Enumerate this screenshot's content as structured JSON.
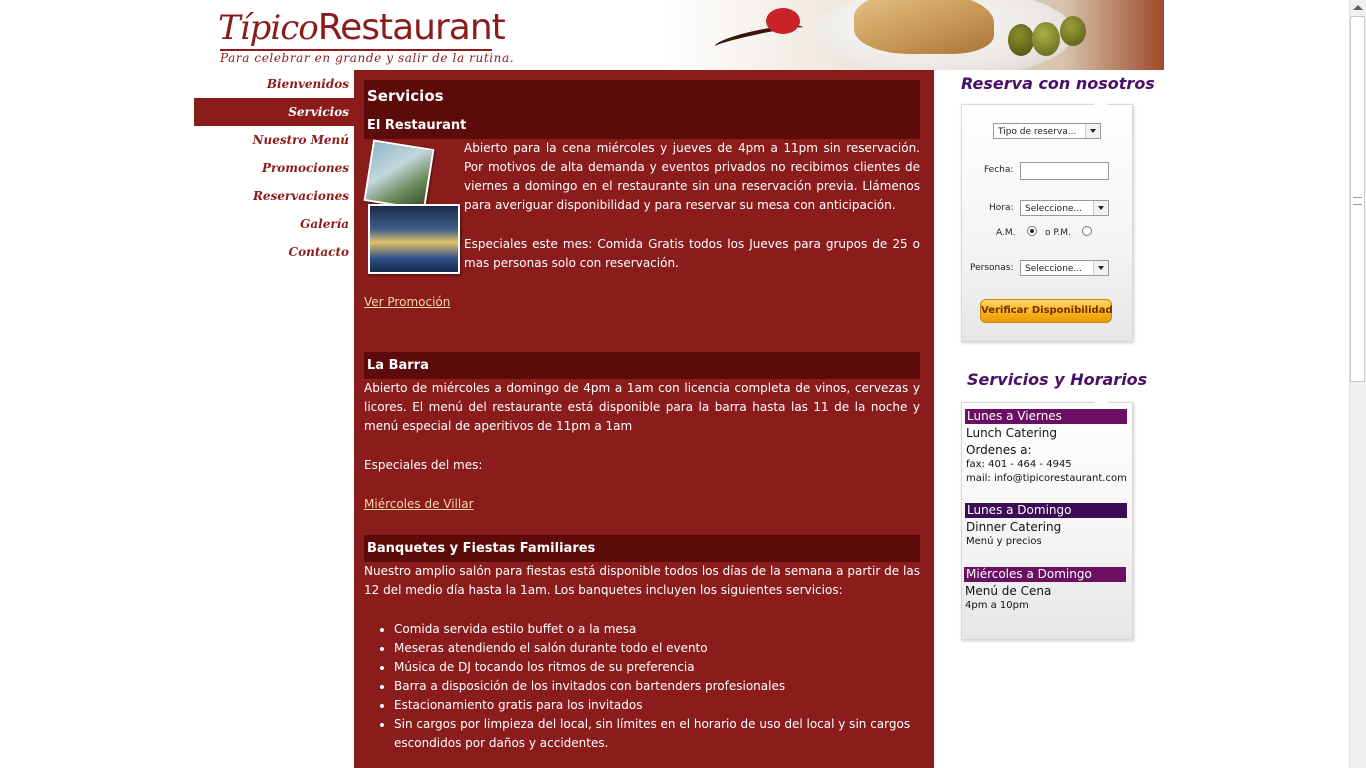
{
  "brand": {
    "name_italic": "Típico",
    "name_rest": "Restaurant",
    "tagline": "Para celebrar en grande y salir de la rutina."
  },
  "nav": {
    "items": [
      {
        "label": "Bienvenidos"
      },
      {
        "label": "Servicios",
        "active": true
      },
      {
        "label": "Nuestro Menú"
      },
      {
        "label": "Promociones"
      },
      {
        "label": "Reservaciones"
      },
      {
        "label": "Galería"
      },
      {
        "label": "Contacto"
      }
    ]
  },
  "main": {
    "title": "Servicios",
    "restaurant": {
      "heading": "El Restaurant",
      "p1": "Abierto para la cena miércoles y jueves de 4pm a 11pm sin reservación. Por motivos de alta demanda y eventos privados no recibimos clientes de viernes a domingo en el restaurante sin una reservación previa. Llámenos para averiguar disponibilidad y para reservar su mesa con anticipación.",
      "p2": "Especiales este mes: Comida Gratis todos los Jueves para grupos de 25 o mas personas solo con reservación.",
      "link": "Ver Promoción"
    },
    "barra": {
      "heading": "La Barra",
      "p1": "Abierto de miércoles a domingo de 4pm a 1am con licencia completa de vinos, cervezas y licores. El menú del restaurante está disponible para la barra hasta las 11 de la noche y menú especial de aperitivos de 11pm a 1am",
      "p2": "Especiales del mes:",
      "link": "Miércoles de Villar"
    },
    "banquetes": {
      "heading": "Banquetes y Fiestas Familiares",
      "p1": "Nuestro amplio salón para fiestas está disponible todos los días de la semana a partir de las 12 del medio día hasta la 1am. Los banquetes incluyen los siguientes servicios:",
      "items": [
        "Comida servida estilo buffet o a la mesa",
        "Meseras atendiendo el salón durante todo el evento",
        "Música de DJ tocando los ritmos de su preferencia",
        "Barra a disposición de los invitados con bartenders profesionales",
        "Estacionamiento gratis para los invitados",
        "Sin cargos por limpieza del local, sin límites en el horario de uso del local y sin cargos escondidos por daños y accidentes."
      ]
    }
  },
  "reserva": {
    "title": "Reserva con nosotros",
    "tipo_select": "Tipo de reserva...",
    "fecha_label": "Fecha:",
    "fecha_value": "",
    "hora_label": "Hora:",
    "hora_select": "Seleccione...",
    "am_label": "A.M.",
    "pm_label": "o P.M.",
    "am_selected": true,
    "personas_label": "Personas:",
    "personas_select": "Seleccione...",
    "button": "Verificar Disponibilidad"
  },
  "horarios": {
    "title": "Servicios y Horarios",
    "blocks": [
      {
        "day": "Lunes a Viernes",
        "color": "#6b0f63",
        "title": "Lunch Catering",
        "lines": [
          "Ordenes a:",
          "fax: 401 - 464 - 4945",
          "mail: info@tipicorestaurant.com"
        ]
      },
      {
        "day": "Lunes a Domingo",
        "color": "#3d0a55",
        "title": "Dinner Catering",
        "lines": [
          "Menú y precios"
        ]
      },
      {
        "day": "Miércoles a Domingo",
        "color": "#6b0f63",
        "title": "Menú de Cena",
        "lines": [
          "4pm a 10pm"
        ]
      }
    ]
  },
  "colors": {
    "main_bg": "#8b1c1c",
    "heading_bg": "#5c0a0a",
    "link": "#f3d7a6",
    "sidebar_title": "#4a1066"
  }
}
